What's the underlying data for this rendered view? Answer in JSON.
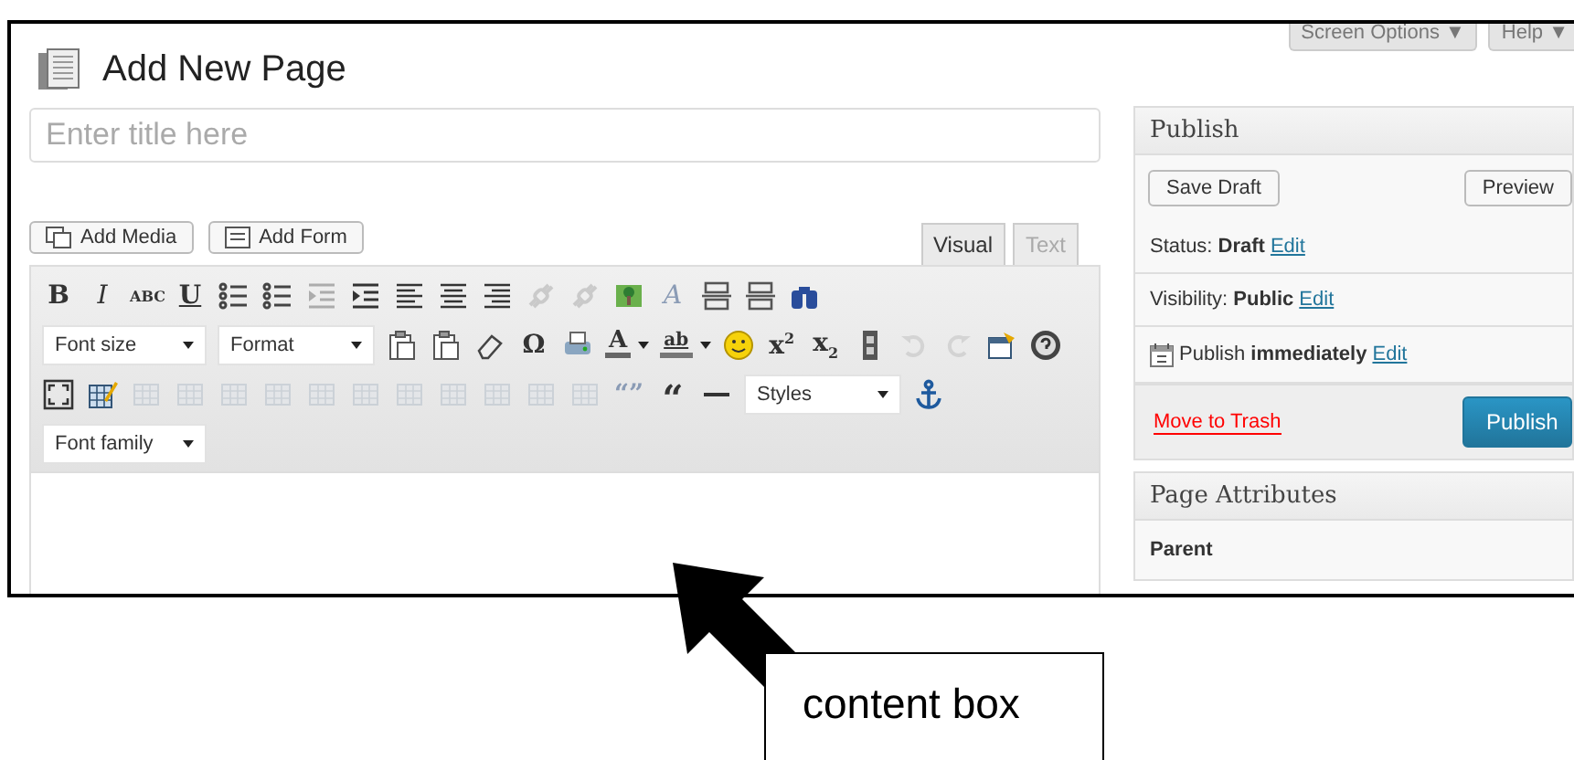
{
  "header": {
    "title": "Add New Page",
    "top_tabs": [
      {
        "label": "Screen Options ▼"
      },
      {
        "label": "Help ▼"
      }
    ]
  },
  "editor": {
    "title_placeholder": "Enter title here",
    "media_buttons": [
      {
        "kind": "media",
        "label": "Add Media"
      },
      {
        "kind": "form",
        "label": "Add Form"
      }
    ],
    "tabs": [
      {
        "label": "Visual",
        "selected": true
      },
      {
        "label": "Text",
        "selected": false
      }
    ],
    "toolbar": [
      [
        {
          "kind": "bold",
          "text": "B",
          "disabled": false
        },
        {
          "kind": "italic",
          "text": "I",
          "disabled": false
        },
        {
          "kind": "strike",
          "text": "ABC",
          "disabled": false
        },
        {
          "kind": "underline",
          "text": "U",
          "disabled": false
        },
        {
          "kind": "bullets",
          "disabled": false
        },
        {
          "kind": "numbers",
          "disabled": false
        },
        {
          "kind": "outdent",
          "disabled": true
        },
        {
          "kind": "indent",
          "disabled": false
        },
        {
          "kind": "align-left",
          "disabled": false
        },
        {
          "kind": "align-center",
          "disabled": false
        },
        {
          "kind": "align-right",
          "disabled": false
        },
        {
          "kind": "link",
          "disabled": true
        },
        {
          "kind": "unlink",
          "disabled": true
        },
        {
          "kind": "image",
          "disabled": false
        },
        {
          "kind": "clean",
          "text": "A",
          "disabled": true
        },
        {
          "kind": "more",
          "disabled": false
        },
        {
          "kind": "pagebreak",
          "disabled": false
        },
        {
          "kind": "find",
          "disabled": false
        }
      ],
      [
        {
          "kind": "select",
          "text": "Font size"
        },
        {
          "kind": "select",
          "text": "Format"
        },
        {
          "kind": "paste",
          "disabled": false
        },
        {
          "kind": "paste",
          "disabled": false
        },
        {
          "kind": "eraser",
          "disabled": false
        },
        {
          "kind": "symbol",
          "text": "Ω",
          "disabled": false
        },
        {
          "kind": "print",
          "disabled": false
        },
        {
          "kind": "color",
          "text": "A",
          "disabled": false
        },
        {
          "kind": "highlight",
          "text": "ab",
          "disabled": false
        },
        {
          "kind": "smiley",
          "disabled": false
        },
        {
          "kind": "sup",
          "text": "x$^{2}$",
          "disabled": false
        },
        {
          "kind": "sub",
          "text": "x$_{2}$",
          "disabled": false
        },
        {
          "kind": "film",
          "disabled": false
        },
        {
          "kind": "undo",
          "disabled": true
        },
        {
          "kind": "redo",
          "disabled": true
        },
        {
          "kind": "box",
          "disabled": false
        },
        {
          "kind": "help",
          "disabled": false
        }
      ],
      [
        {
          "kind": "fullscreen",
          "disabled": false
        },
        {
          "kind": "table-edit",
          "disabled": false
        },
        {
          "kind": "table",
          "disabled": true
        },
        {
          "kind": "table",
          "disabled": true
        },
        {
          "kind": "table",
          "disabled": true
        },
        {
          "kind": "table",
          "disabled": true
        },
        {
          "kind": "table",
          "disabled": true
        },
        {
          "kind": "table",
          "disabled": true
        },
        {
          "kind": "table",
          "disabled": true
        },
        {
          "kind": "table",
          "disabled": true
        },
        {
          "kind": "table",
          "disabled": true
        },
        {
          "kind": "table",
          "disabled": true
        },
        {
          "kind": "table",
          "disabled": true
        },
        {
          "kind": "blockquote",
          "text": "“”",
          "disabled": true
        },
        {
          "kind": "quote",
          "text": "“",
          "disabled": false
        },
        {
          "kind": "hr",
          "disabled": false
        },
        {
          "kind": "select",
          "text": "Styles"
        },
        {
          "kind": "anchor",
          "disabled": false
        }
      ],
      [
        {
          "kind": "select",
          "text": "Font family"
        }
      ]
    ]
  },
  "publish": {
    "title": "Publish",
    "save": "Save Draft",
    "preview": "Preview",
    "rows": [
      {
        "kind": "plain",
        "text": "Status: **Draft**",
        "link": "Edit"
      },
      {
        "kind": "plain",
        "text": "Visibility: **Public**",
        "link": "Edit"
      },
      {
        "kind": "schedule",
        "text": "Publish **immediately**",
        "link": "Edit"
      }
    ],
    "trash": "Move to Trash",
    "button": "Publish"
  },
  "page_attributes": {
    "title": "Page Attributes",
    "label": "Parent"
  },
  "annotation": {
    "text": "content box"
  }
}
